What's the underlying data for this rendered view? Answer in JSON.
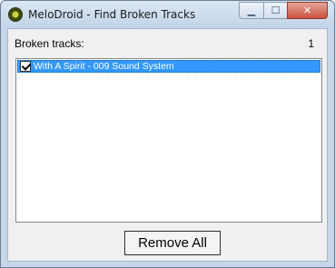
{
  "window": {
    "title": "MeloDroid - Find Broken Tracks",
    "app_icon": "melodroid-icon",
    "caption_buttons": {
      "minimize": "▁",
      "maximize": "☐",
      "close": "✕"
    }
  },
  "broken": {
    "label": "Broken tracks:",
    "count": "1",
    "items": [
      {
        "label": "With A Spirit - 009 Sound System",
        "checked": true,
        "selected": true
      }
    ]
  },
  "actions": {
    "remove_all": "Remove All"
  },
  "colors": {
    "selection": "#3399ff",
    "client_bg": "#f0f0f0",
    "titlebar": "#c6d6e8"
  }
}
